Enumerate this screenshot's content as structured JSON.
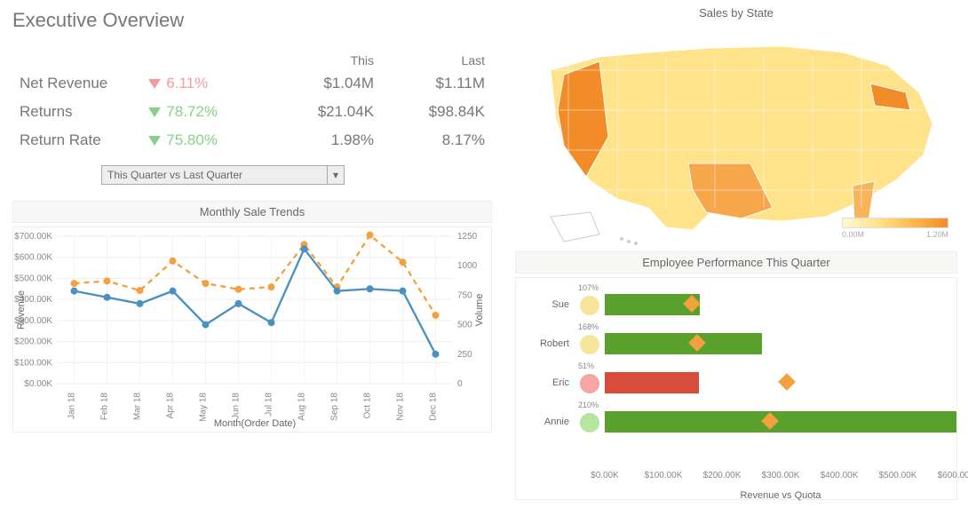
{
  "title": "Executive Overview",
  "kpi": {
    "headers": {
      "this": "This",
      "last": "Last"
    },
    "rows": [
      {
        "name": "Net Revenue",
        "pct": "6.11%",
        "dir": "down",
        "tone": "red",
        "this": "$1.04M",
        "last": "$1.11M"
      },
      {
        "name": "Returns",
        "pct": "78.72%",
        "dir": "down",
        "tone": "green",
        "this": "$21.04K",
        "last": "$98.84K"
      },
      {
        "name": "Return Rate",
        "pct": "75.80%",
        "dir": "down",
        "tone": "green",
        "this": "1.98%",
        "last": "8.17%"
      }
    ]
  },
  "selector": {
    "label": "This Quarter vs Last Quarter"
  },
  "trends_title": "Monthly Sale Trends",
  "map_title": "Sales by State",
  "emp_title": "Employee Performance This Quarter",
  "legend": {
    "min": "0.00M",
    "max": "1.20M"
  },
  "chart_data": [
    {
      "id": "monthly_trends",
      "type": "line",
      "title": "Monthly Sale Trends",
      "xlabel": "Month(Order Date)",
      "ylabel": "Revenue",
      "y2label": "Volume",
      "categories": [
        "Jan 18",
        "Feb 18",
        "Mar 18",
        "Apr 18",
        "May 18",
        "Jun 18",
        "Jul 18",
        "Aug 18",
        "Sep 18",
        "Oct 18",
        "Nov 18",
        "Dec 18"
      ],
      "ylim": [
        0,
        700000
      ],
      "y2lim": [
        0,
        1250
      ],
      "series": [
        {
          "name": "Revenue",
          "axis": "left",
          "values": [
            440000,
            410000,
            380000,
            440000,
            280000,
            380000,
            290000,
            640000,
            440000,
            450000,
            440000,
            140000
          ]
        },
        {
          "name": "Volume",
          "axis": "right",
          "style": "dashed",
          "values": [
            850,
            870,
            790,
            1040,
            850,
            800,
            820,
            1180,
            820,
            1260,
            1030,
            580
          ]
        }
      ]
    },
    {
      "id": "sales_by_state",
      "type": "choropleth",
      "title": "Sales by State",
      "legend_range": [
        0,
        1200000
      ],
      "note": "US states shaded by sales; CA, TX, PA, FL among highest"
    },
    {
      "id": "employee_performance",
      "type": "bar",
      "title": "Employee Performance This Quarter",
      "xlabel": "Revenue vs Quota",
      "categories": [
        "Sue",
        "Robert",
        "Eric",
        "Annie"
      ],
      "xlim": [
        0,
        600000
      ],
      "series": [
        {
          "name": "Revenue",
          "values": [
            162000,
            268000,
            160000,
            600000
          ],
          "colors": [
            "#5aa02c",
            "#5aa02c",
            "#d94b3a",
            "#5aa02c"
          ]
        },
        {
          "name": "Quota",
          "marker": "diamond",
          "values": [
            151000,
            160000,
            315000,
            286000
          ]
        },
        {
          "name": "Pct of Quota",
          "values": [
            "107%",
            "168%",
            "51%",
            "210%"
          ],
          "dot_colors": [
            "#f6e59a",
            "#f6e59a",
            "#f4a6a6",
            "#b5e6a0"
          ]
        }
      ],
      "xticks": [
        "$0.00K",
        "$100.00K",
        "$200.00K",
        "$300.00K",
        "$400.00K",
        "$500.00K",
        "$600.00K"
      ]
    }
  ]
}
